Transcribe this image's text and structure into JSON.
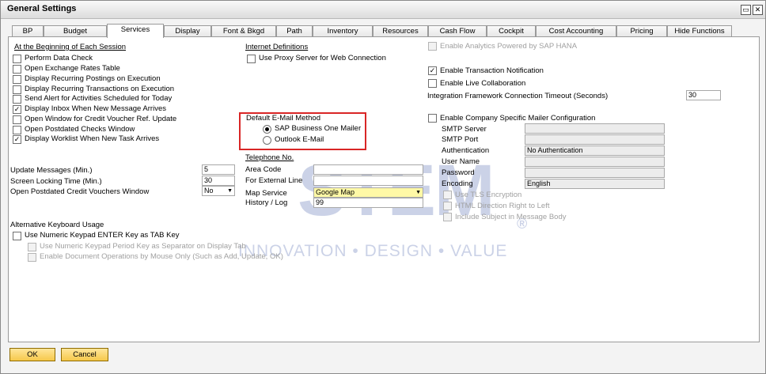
{
  "window": {
    "title": "General Settings"
  },
  "tabs": [
    "BP",
    "Budget",
    "Services",
    "Display",
    "Font & Bkgd",
    "Path",
    "Inventory",
    "Resources",
    "Cash Flow",
    "Cockpit",
    "Cost Accounting",
    "Pricing",
    "Hide Functions"
  ],
  "session": {
    "header": "At the Beginning of Each Session",
    "items": [
      {
        "label": "Perform Data Check",
        "checked": false
      },
      {
        "label": "Open Exchange Rates Table",
        "checked": false
      },
      {
        "label": "Display Recurring Postings on Execution",
        "checked": false
      },
      {
        "label": "Display Recurring Transactions on Execution",
        "checked": false
      },
      {
        "label": "Send Alert for Activities Scheduled for Today",
        "checked": false
      },
      {
        "label": "Display Inbox When New Message Arrives",
        "checked": true
      },
      {
        "label": "Open Window for Credit Voucher Ref. Update",
        "checked": false
      },
      {
        "label": "Open Postdated Checks Window",
        "checked": false
      },
      {
        "label": "Display Worklist When New Task Arrives",
        "checked": true
      }
    ]
  },
  "timing": {
    "update_label": "Update Messages (Min.)",
    "update_value": "5",
    "lock_label": "Screen Locking Time (Min.)",
    "lock_value": "30",
    "vouchers_label": "Open Postdated Credit Vouchers Window",
    "vouchers_value": "No"
  },
  "keyboard": {
    "header": "Alternative Keyboard Usage",
    "enter_label": "Use Numeric Keypad ENTER Key as TAB Key",
    "period_label": "Use Numeric Keypad Period Key as Separator on Display Tab",
    "mouse_label": "Enable Document Operations by Mouse Only (Such as Add, Update, OK)"
  },
  "internet": {
    "header": "Internet Definitions",
    "proxy_label": "Use Proxy Server for Web Connection"
  },
  "email": {
    "header": "Default E-Mail Method",
    "option1": "SAP Business One Mailer",
    "option2": "Outlook E-Mail"
  },
  "telephone": {
    "header": "Telephone No.",
    "area_label": "Area Code",
    "external_label": "For External Line",
    "map_label": "Map Service",
    "map_value": "Google Map",
    "history_label": "History / Log",
    "history_value": "99"
  },
  "right": {
    "analytics_label": "Enable Analytics Powered by SAP HANA",
    "notification_label": "Enable Transaction Notification",
    "collab_label": "Enable Live Collaboration",
    "timeout_label": "Integration Framework Connection Timeout (Seconds)",
    "timeout_value": "30",
    "mailer_label": "Enable Company Specific Mailer Configuration",
    "smtp_server": "SMTP Server",
    "smtp_port": "SMTP Port",
    "auth_label": "Authentication",
    "auth_value": "No Authentication",
    "user_label": "User Name",
    "password_label": "Password",
    "encoding_label": "Encoding",
    "encoding_value": "English",
    "tls_label": "Use TLS Encryption",
    "html_label": "HTML Direction Right to Left",
    "subject_label": "Include Subject in Message Body"
  },
  "buttons": {
    "ok": "OK",
    "cancel": "Cancel"
  },
  "watermark": {
    "brand": "STEM",
    "registered": "®",
    "slogan": "INNOVATION • DESIGN • VALUE"
  },
  "colors": {
    "highlight": "#d92626",
    "button": "#f6c84b",
    "map_field": "#fff9a6"
  }
}
